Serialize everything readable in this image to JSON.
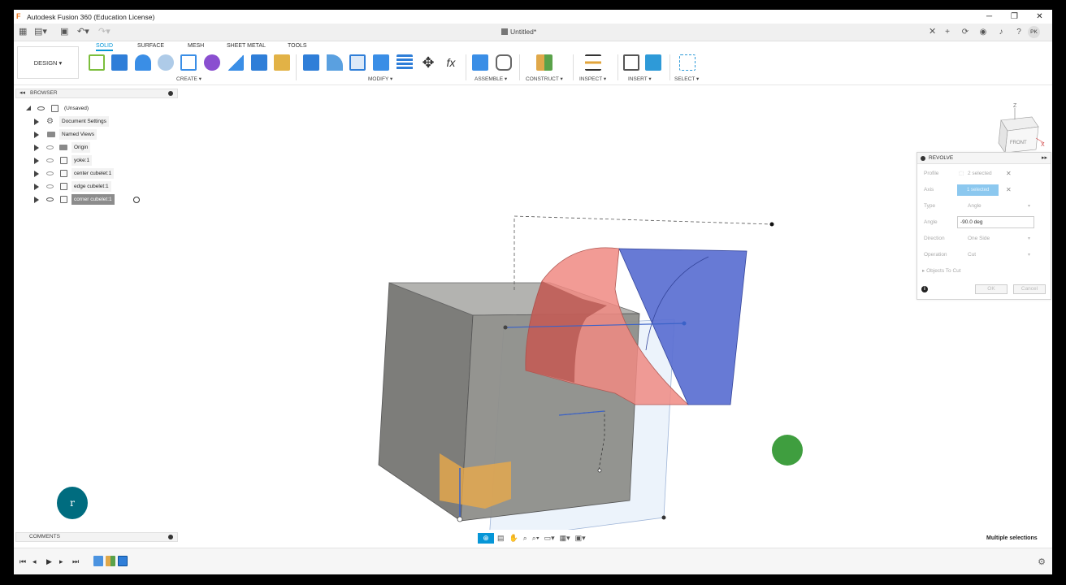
{
  "window": {
    "title": "Autodesk Fusion 360 (Education License)",
    "minimize": "─",
    "restore": "❐",
    "close": "✕"
  },
  "quick_access": {
    "document_title": "Untitled*",
    "close_doc": "✕",
    "add_tab": "+",
    "user_initials": "PK"
  },
  "workspace": {
    "label": "DESIGN ▾"
  },
  "tabs": [
    {
      "label": "SOLID",
      "active": true
    },
    {
      "label": "SURFACE"
    },
    {
      "label": "MESH"
    },
    {
      "label": "SHEET METAL"
    },
    {
      "label": "TOOLS"
    }
  ],
  "groups": {
    "create": "CREATE ▾",
    "modify": "MODIFY ▾",
    "assemble": "ASSEMBLE ▾",
    "construct": "CONSTRUCT ▾",
    "inspect": "INSPECT ▾",
    "insert": "INSERT ▾",
    "select": "SELECT ▾"
  },
  "browser": {
    "title": "BROWSER",
    "items": [
      {
        "label": "(Unsaved)"
      },
      {
        "label": "Document Settings"
      },
      {
        "label": "Named Views"
      },
      {
        "label": "Origin"
      },
      {
        "label": "yoke:1"
      },
      {
        "label": "center cubelet:1"
      },
      {
        "label": "edge cubelet:1"
      },
      {
        "label": "corner cubelet:1"
      }
    ]
  },
  "revolve": {
    "title": "REVOLVE",
    "profile_label": "Profile",
    "profile_value": "2 selected",
    "axis_label": "Axis",
    "axis_value": "1 selected",
    "type_label": "Type",
    "type_value": "Angle",
    "angle_label": "Angle",
    "angle_value": "-90.0 deg",
    "direction_label": "Direction",
    "direction_value": "One Side",
    "operation_label": "Operation",
    "operation_value": "Cut",
    "objects_to_cut": "Objects To Cut",
    "ok": "OK",
    "cancel": "Cancel"
  },
  "viewcube": {
    "front": "FRONT",
    "z": "Z",
    "x": "X"
  },
  "comments": {
    "title": "COMMENTS"
  },
  "status": {
    "text": "Multiple selections"
  },
  "user_bubble": {
    "letter": "r"
  },
  "colors": {
    "accent": "#0696d7",
    "cut_body": "#f08a82",
    "blue_body": "#5a6fd1",
    "gray_body": "#8e8e8a",
    "green_marker": "#3f9e3f",
    "teal_bubble": "#006c7f"
  }
}
